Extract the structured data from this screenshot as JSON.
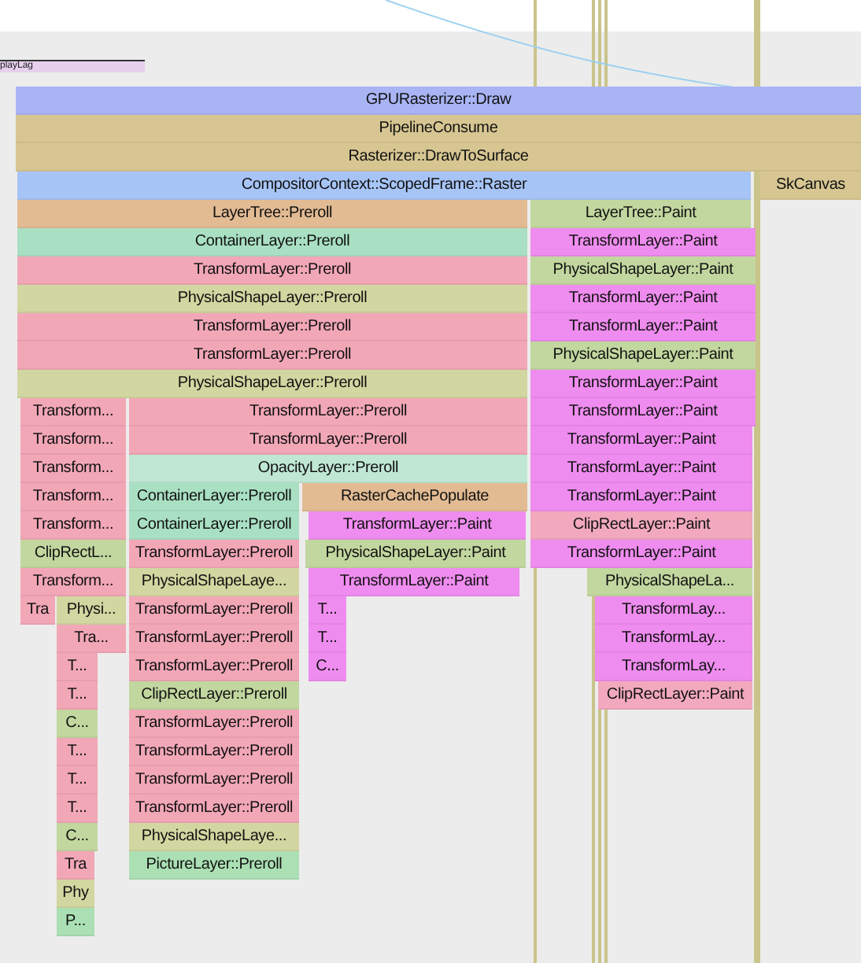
{
  "marker": {
    "label": "playLag"
  },
  "tracks": [
    {
      "slices": [
        {
          "label": "GPURasterizer::Draw",
          "kind": "gpu"
        }
      ]
    },
    {
      "slices": [
        {
          "label": "PipelineConsume",
          "kind": "pipeline"
        }
      ]
    },
    {
      "slices": [
        {
          "label": "Rasterizer::DrawToSurface",
          "kind": "pipeline"
        }
      ]
    },
    {
      "slices": [
        {
          "label": "CompositorContext::ScopedFrame::Raster",
          "kind": "compositor"
        },
        {
          "label": "SkCanvas",
          "kind": "pipeline"
        }
      ]
    },
    {
      "slices": [
        {
          "label": "LayerTree::Preroll",
          "kind": "tree"
        },
        {
          "label": "LayerTree::Paint",
          "kind": "leaf"
        }
      ]
    },
    {
      "slices": [
        {
          "label": "ContainerLayer::Preroll",
          "kind": "container"
        },
        {
          "label": "TransformLayer::Paint",
          "kind": "paint"
        }
      ]
    },
    {
      "slices": [
        {
          "label": "TransformLayer::Preroll",
          "kind": "transform"
        },
        {
          "label": "PhysicalShapeLayer::Paint",
          "kind": "leaf"
        }
      ]
    },
    {
      "slices": [
        {
          "label": "PhysicalShapeLayer::Preroll",
          "kind": "physical"
        },
        {
          "label": "TransformLayer::Paint",
          "kind": "paint"
        }
      ]
    },
    {
      "slices": [
        {
          "label": "TransformLayer::Preroll",
          "kind": "transform"
        },
        {
          "label": "TransformLayer::Paint",
          "kind": "paint"
        }
      ]
    },
    {
      "slices": [
        {
          "label": "TransformLayer::Preroll",
          "kind": "transform"
        },
        {
          "label": "PhysicalShapeLayer::Paint",
          "kind": "leaf"
        }
      ]
    },
    {
      "slices": [
        {
          "label": "PhysicalShapeLayer::Preroll",
          "kind": "physical"
        },
        {
          "label": "TransformLayer::Paint",
          "kind": "paint"
        }
      ]
    },
    {
      "slices": [
        {
          "label": "Transform...",
          "kind": "transform"
        },
        {
          "label": "TransformLayer::Preroll",
          "kind": "transform"
        },
        {
          "label": "TransformLayer::Paint",
          "kind": "paint"
        }
      ]
    },
    {
      "slices": [
        {
          "label": "Transform...",
          "kind": "transform"
        },
        {
          "label": "TransformLayer::Preroll",
          "kind": "transform"
        },
        {
          "label": "TransformLayer::Paint",
          "kind": "paint"
        }
      ]
    },
    {
      "slices": [
        {
          "label": "Transform...",
          "kind": "transform"
        },
        {
          "label": "OpacityLayer::Preroll",
          "kind": "opacity"
        },
        {
          "label": "TransformLayer::Paint",
          "kind": "paint"
        }
      ]
    },
    {
      "slices": [
        {
          "label": "Transform...",
          "kind": "transform"
        },
        {
          "label": "ContainerLayer::Preroll",
          "kind": "container"
        },
        {
          "label": "RasterCachePopulate",
          "kind": "tree"
        },
        {
          "label": "TransformLayer::Paint",
          "kind": "paint"
        }
      ]
    },
    {
      "slices": [
        {
          "label": "Transform...",
          "kind": "transform"
        },
        {
          "label": "ContainerLayer::Preroll",
          "kind": "container"
        },
        {
          "label": "TransformLayer::Paint",
          "kind": "paint"
        },
        {
          "label": "ClipRectLayer::Paint",
          "kind": "clippaint"
        }
      ]
    },
    {
      "slices": [
        {
          "label": "ClipRectL...",
          "kind": "leaf"
        },
        {
          "label": "TransformLayer::Preroll",
          "kind": "transform"
        },
        {
          "label": "PhysicalShapeLayer::Paint",
          "kind": "leaf"
        },
        {
          "label": "TransformLayer::Paint",
          "kind": "paint"
        }
      ]
    },
    {
      "slices": [
        {
          "label": "Transform...",
          "kind": "transform"
        },
        {
          "label": "PhysicalShapeLaye...",
          "kind": "physical"
        },
        {
          "label": "TransformLayer::Paint",
          "kind": "paint"
        },
        {
          "label": "PhysicalShapeLa...",
          "kind": "leaf"
        }
      ]
    },
    {
      "slices": [
        {
          "label": "Tra",
          "kind": "transform"
        },
        {
          "label": "Physi...",
          "kind": "physical"
        },
        {
          "label": "TransformLayer::Preroll",
          "kind": "transform"
        },
        {
          "label": "T...",
          "kind": "paint"
        },
        {
          "label": "TransformLay...",
          "kind": "paint"
        }
      ]
    },
    {
      "slices": [
        {
          "label": "Tra...",
          "kind": "transform"
        },
        {
          "label": "TransformLayer::Preroll",
          "kind": "transform"
        },
        {
          "label": "T...",
          "kind": "paint"
        },
        {
          "label": "TransformLay...",
          "kind": "paint"
        }
      ]
    },
    {
      "slices": [
        {
          "label": "T...",
          "kind": "transform"
        },
        {
          "label": "TransformLayer::Preroll",
          "kind": "transform"
        },
        {
          "label": "C...",
          "kind": "paint"
        },
        {
          "label": "TransformLay...",
          "kind": "paint"
        }
      ]
    },
    {
      "slices": [
        {
          "label": "T...",
          "kind": "transform"
        },
        {
          "label": "ClipRectLayer::Preroll",
          "kind": "leaf"
        },
        {
          "label": "ClipRectLayer::Paint",
          "kind": "clippaint"
        }
      ]
    },
    {
      "slices": [
        {
          "label": "C...",
          "kind": "leaf"
        },
        {
          "label": "TransformLayer::Preroll",
          "kind": "transform"
        }
      ]
    },
    {
      "slices": [
        {
          "label": "T...",
          "kind": "transform"
        },
        {
          "label": "TransformLayer::Preroll",
          "kind": "transform"
        }
      ]
    },
    {
      "slices": [
        {
          "label": "T...",
          "kind": "transform"
        },
        {
          "label": "TransformLayer::Preroll",
          "kind": "transform"
        }
      ]
    },
    {
      "slices": [
        {
          "label": "T...",
          "kind": "transform"
        },
        {
          "label": "TransformLayer::Preroll",
          "kind": "transform"
        }
      ]
    },
    {
      "slices": [
        {
          "label": "C...",
          "kind": "leaf"
        },
        {
          "label": "PhysicalShapeLaye...",
          "kind": "physical"
        }
      ]
    },
    {
      "slices": [
        {
          "label": "Tra",
          "kind": "transform"
        },
        {
          "label": "PictureLayer::Preroll",
          "kind": "picture"
        }
      ]
    },
    {
      "slices": [
        {
          "label": "Phy",
          "kind": "physical"
        }
      ]
    },
    {
      "slices": [
        {
          "label": "P...",
          "kind": "picture"
        }
      ]
    }
  ]
}
